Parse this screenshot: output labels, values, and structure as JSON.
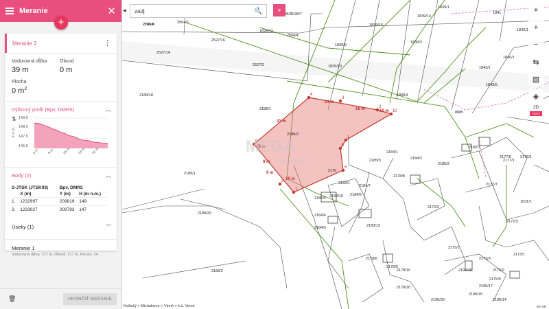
{
  "header": {
    "title": "Meranie"
  },
  "card": {
    "title": "Meranie 2",
    "horizontal_label": "Vodorovná dĺžka",
    "horizontal_value": "39 m",
    "perimeter_label": "Obvod",
    "perimeter_value": "0 m",
    "area_label": "Plocha",
    "area_value": "0 m",
    "area_unit_exp": "2"
  },
  "profile": {
    "title": "Výškový profil (Bpv, DMR5)",
    "y_unit": "m n.m.",
    "y_ticks": [
      "149.5",
      "148.5",
      "147.5",
      "146.5"
    ],
    "x_ticks": [
      "0 m",
      "8 m",
      "16 m",
      "24 m",
      "31 m"
    ]
  },
  "chart_data": {
    "type": "area",
    "x": [
      0,
      2,
      4,
      6,
      8,
      10,
      12,
      14,
      16,
      18,
      20,
      22,
      24,
      26,
      28,
      30,
      32,
      34,
      36,
      38,
      39
    ],
    "values": [
      149.0,
      149.0,
      148.9,
      148.7,
      148.6,
      148.4,
      148.3,
      148.1,
      148.0,
      147.8,
      147.7,
      147.6,
      147.4,
      147.3,
      147.3,
      147.2,
      147.1,
      147.1,
      147.0,
      147.0,
      147.0
    ],
    "ylim": [
      146.5,
      149.5
    ],
    "xlim": [
      0,
      39
    ],
    "color": "#e84f7e"
  },
  "points": {
    "title": "Body (2)",
    "system": "S-JTSK (JTSK03)",
    "height_system": "Bpv, DMR5",
    "columns": [
      "X (m)",
      "Y (m)",
      "H (m n.m.)"
    ],
    "rows": [
      {
        "index": "1.",
        "x": "1232997",
        "y": "209819",
        "h": "149"
      },
      {
        "index": "2.",
        "x": "1233027",
        "y": "209793",
        "h": "147"
      }
    ]
  },
  "segments": {
    "title": "Úseky (1)"
  },
  "measurement": {
    "name": "Meranie 1",
    "desc": "Vodorovná dĺžka: 217 m, Obvod: 217 m, Plocha: 24…"
  },
  "footer": {
    "end_label": "UKONČIŤ MERANIE"
  },
  "search": {
    "placeholder": "zadj"
  },
  "map": {
    "breadcrumb": "Košický > Michalovce > Vinné > k.ú. Vinné",
    "attribution": "MY SR",
    "label_3d": "3D",
    "test_label": "TEST",
    "watermark_mid": "MEGA",
    "watermark_sub": "KANCEL",
    "parcels": [
      "2240/4",
      "2554/1",
      "2554/4",
      "2527/16",
      "2527/14",
      "2527/2",
      "2189/18",
      "2188/1",
      "2189/1",
      "2189/20",
      "2189/2",
      "2188/2",
      "1828/7",
      "1828/12",
      "1839/14",
      "1839/15",
      "1839/9",
      "1839/10",
      "1842/1",
      "1841",
      "1843/1",
      "1843/5",
      "1840/1",
      "1839/1",
      "2185/3",
      "2184/1",
      "2184/2",
      "2185/2",
      "2182/1",
      "2177/1",
      "2176/1",
      "2177/7",
      "2177/6",
      "2173/1",
      "2172/3",
      "2172/2",
      "2178/8",
      "2183/1",
      "2184/6",
      "2184/7",
      "2184/3",
      "2184/4",
      "2185/6",
      "2183/10",
      "2183/13",
      "2178/6",
      "2178/5",
      "2178/20",
      "2178/10",
      "2175/1",
      "2175/2",
      "2175/5",
      "2173/3",
      "2190/35",
      "2190/17",
      "2190/15",
      "2190/14",
      "2190/30",
      "1839/3",
      "1830/4",
      "1628/7",
      "8885",
      "1631/1",
      "2170",
      "2189/8"
    ],
    "measure_labels": [
      "24 m",
      "18 m",
      "10 m",
      "41 m",
      "9 m",
      "8 m",
      "15 m",
      "10 m"
    ],
    "vertices": [
      "4",
      "3",
      "2",
      "10",
      "1",
      "5",
      "6",
      "7",
      "8",
      "9"
    ]
  }
}
